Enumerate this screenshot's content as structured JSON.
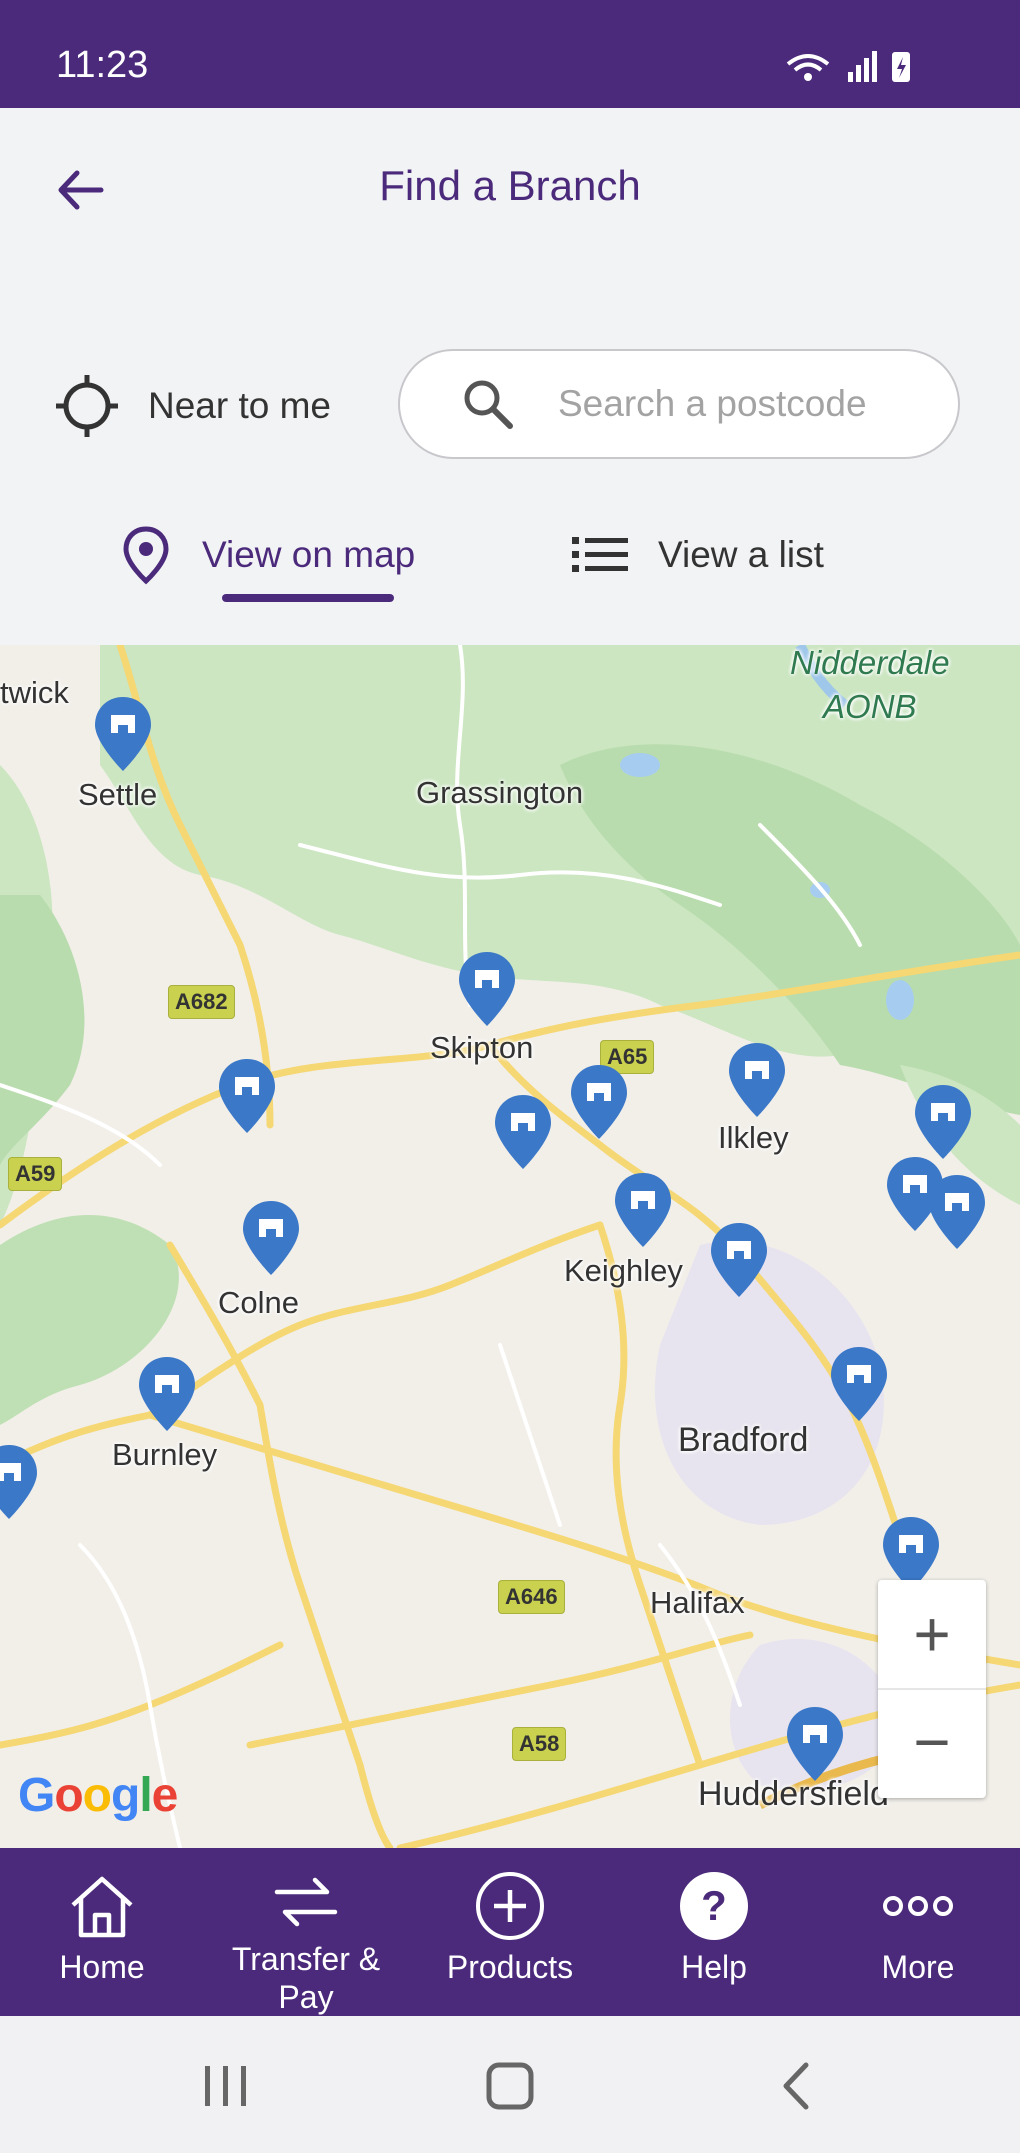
{
  "status_bar": {
    "time": "11:23"
  },
  "header": {
    "title": "Find a Branch"
  },
  "controls": {
    "near_me_label": "Near to me",
    "search_placeholder": "Search a postcode"
  },
  "tabs": {
    "map_label": "View on map",
    "list_label": "View a list",
    "active": "map"
  },
  "map": {
    "labels": {
      "twick": "twick",
      "settle": "Settle",
      "grassington": "Grassington",
      "skipton": "Skipton",
      "ilkley": "Ilkley",
      "colne": "Colne",
      "keighley": "Keighley",
      "burnley": "Burnley",
      "bradford": "Bradford",
      "halifax": "Halifax",
      "huddersfield": "Huddersfield",
      "aonb_line1": "Nidderdale",
      "aonb_line2": "AONB"
    },
    "roads": {
      "a682": "A682",
      "a65": "A65",
      "a59": "A59",
      "a646": "A646",
      "a58": "A58"
    },
    "zoom_in": "+",
    "zoom_out": "−",
    "attribution": "Google"
  },
  "bottom_nav": {
    "home": "Home",
    "transfer": "Transfer &\nPay",
    "products": "Products",
    "help": "Help",
    "more": "More"
  },
  "colors": {
    "brand": "#4b2a7b",
    "pin": "#3b78c8"
  }
}
